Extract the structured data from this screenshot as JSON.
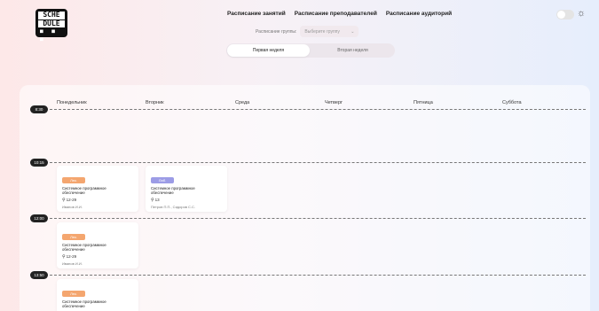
{
  "logo": {
    "line1": "SCHE",
    "line2": "DULE",
    "dots": "■ ■ ■"
  },
  "nav": {
    "groups": "Расписание занятий",
    "teachers": "Расписание преподавателей",
    "rooms": "Расписание аудиторий"
  },
  "group": {
    "label": "Расписание группы:",
    "value": "Выберите группу",
    "chevron": "⌄"
  },
  "theme": {
    "icon": "☼"
  },
  "weeks": {
    "first": "Первая неделя",
    "second": "Вторая неделя"
  },
  "days": [
    "Понедельник",
    "Вторник",
    "Среда",
    "Четверг",
    "Пятница",
    "Суббота"
  ],
  "times": [
    "8:30",
    "10:15",
    "12:00",
    "13:50"
  ],
  "lessons": [
    {
      "type": "Лек.",
      "subject": "Системное программное обеспечение",
      "room": "12-29",
      "teacher": "Иванов И.И.",
      "color": "#f4a66f"
    },
    {
      "type": "Лаб.",
      "subject": "Системное программное обеспечение",
      "room": "13",
      "teacher": "Петров П.П., Сидоров С.С.",
      "color": "#9c9ce6"
    },
    {
      "type": "Лек.",
      "subject": "Системное программное обеспечение",
      "room": "12-29",
      "teacher": "Иванов И.И.",
      "color": "#f4a66f"
    },
    {
      "type": "Лек.",
      "subject": "Системное программное обеспечение",
      "room": "",
      "teacher": "",
      "color": "#f4a66f"
    }
  ]
}
